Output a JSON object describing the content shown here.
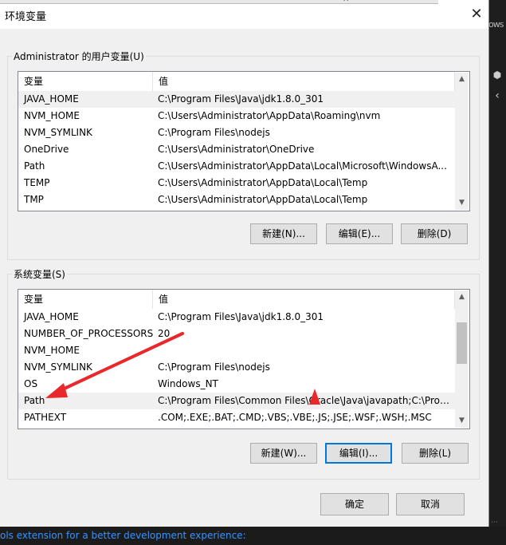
{
  "dialog": {
    "title": "环境变量",
    "close_glyph": "✕"
  },
  "user_vars": {
    "legend": "Administrator 的用户变量(U)",
    "col_name": "变量",
    "col_value": "值",
    "rows": [
      {
        "name": "JAVA_HOME",
        "value": "C:\\Program Files\\Java\\jdk1.8.0_301"
      },
      {
        "name": "NVM_HOME",
        "value": "C:\\Users\\Administrator\\AppData\\Roaming\\nvm"
      },
      {
        "name": "NVM_SYMLINK",
        "value": "C:\\Program Files\\nodejs"
      },
      {
        "name": "OneDrive",
        "value": "C:\\Users\\Administrator\\OneDrive"
      },
      {
        "name": "Path",
        "value": "C:\\Users\\Administrator\\AppData\\Local\\Microsoft\\WindowsA..."
      },
      {
        "name": "TEMP",
        "value": "C:\\Users\\Administrator\\AppData\\Local\\Temp"
      },
      {
        "name": "TMP",
        "value": "C:\\Users\\Administrator\\AppData\\Local\\Temp"
      }
    ],
    "new_label": "新建(N)...",
    "edit_label": "编辑(E)...",
    "delete_label": "删除(D)"
  },
  "system_vars": {
    "legend": "系统变量(S)",
    "col_name": "变量",
    "col_value": "值",
    "rows": [
      {
        "name": "JAVA_HOME",
        "value": "C:\\Program Files\\Java\\jdk1.8.0_301"
      },
      {
        "name": "NUMBER_OF_PROCESSORS",
        "value": "20"
      },
      {
        "name": "NVM_HOME",
        "value": ""
      },
      {
        "name": "NVM_SYMLINK",
        "value": "C:\\Program Files\\nodejs"
      },
      {
        "name": "OS",
        "value": "Windows_NT"
      },
      {
        "name": "Path",
        "value": "C:\\Program Files\\Common Files\\Oracle\\Java\\javapath;C:\\Prog..."
      },
      {
        "name": "PATHEXT",
        "value": ".COM;.EXE;.BAT;.CMD;.VBS;.VBE;.JS;.JSE;.WSF;.WSH;.MSC"
      }
    ],
    "new_label": "新建(W)...",
    "edit_label": "编辑(I)...",
    "delete_label": "删除(L)"
  },
  "footer": {
    "ok_label": "确定",
    "cancel_label": "取消"
  },
  "background": {
    "right_text": "ows",
    "status_text": "ols extension for a better development experience:"
  },
  "annotation": {
    "arrow_color": "#e8282b"
  }
}
